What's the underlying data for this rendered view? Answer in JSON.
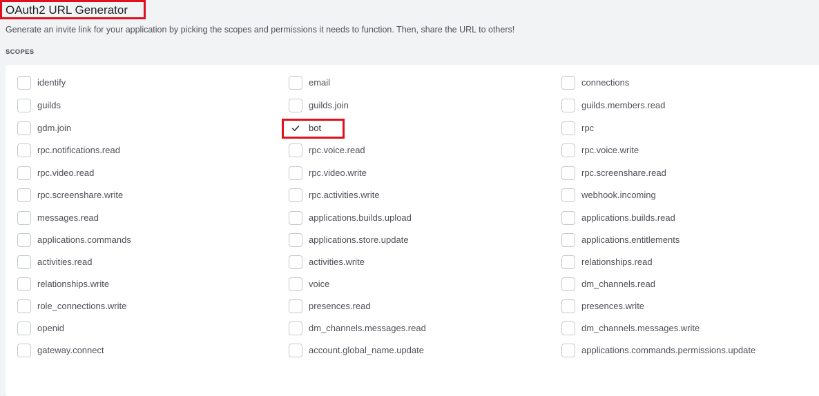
{
  "header": {
    "title": "OAuth2 URL Generator",
    "description": "Generate an invite link for your application by picking the scopes and permissions it needs to function. Then, share the URL to others!"
  },
  "scopes": {
    "section_label": "SCOPES",
    "items": [
      {
        "label": "identify",
        "checked": false
      },
      {
        "label": "email",
        "checked": false
      },
      {
        "label": "connections",
        "checked": false
      },
      {
        "label": "guilds",
        "checked": false
      },
      {
        "label": "guilds.join",
        "checked": false
      },
      {
        "label": "guilds.members.read",
        "checked": false
      },
      {
        "label": "gdm.join",
        "checked": false
      },
      {
        "label": "bot",
        "checked": true
      },
      {
        "label": "rpc",
        "checked": false
      },
      {
        "label": "rpc.notifications.read",
        "checked": false
      },
      {
        "label": "rpc.voice.read",
        "checked": false
      },
      {
        "label": "rpc.voice.write",
        "checked": false
      },
      {
        "label": "rpc.video.read",
        "checked": false
      },
      {
        "label": "rpc.video.write",
        "checked": false
      },
      {
        "label": "rpc.screenshare.read",
        "checked": false
      },
      {
        "label": "rpc.screenshare.write",
        "checked": false
      },
      {
        "label": "rpc.activities.write",
        "checked": false
      },
      {
        "label": "webhook.incoming",
        "checked": false
      },
      {
        "label": "messages.read",
        "checked": false
      },
      {
        "label": "applications.builds.upload",
        "checked": false
      },
      {
        "label": "applications.builds.read",
        "checked": false
      },
      {
        "label": "applications.commands",
        "checked": false
      },
      {
        "label": "applications.store.update",
        "checked": false
      },
      {
        "label": "applications.entitlements",
        "checked": false
      },
      {
        "label": "activities.read",
        "checked": false
      },
      {
        "label": "activities.write",
        "checked": false
      },
      {
        "label": "relationships.read",
        "checked": false
      },
      {
        "label": "relationships.write",
        "checked": false
      },
      {
        "label": "voice",
        "checked": false
      },
      {
        "label": "dm_channels.read",
        "checked": false
      },
      {
        "label": "role_connections.write",
        "checked": false
      },
      {
        "label": "presences.read",
        "checked": false
      },
      {
        "label": "presences.write",
        "checked": false
      },
      {
        "label": "openid",
        "checked": false
      },
      {
        "label": "dm_channels.messages.read",
        "checked": false
      },
      {
        "label": "dm_channels.messages.write",
        "checked": false
      },
      {
        "label": "gateway.connect",
        "checked": false
      },
      {
        "label": "account.global_name.update",
        "checked": false
      },
      {
        "label": "applications.commands.permissions.update",
        "checked": false
      }
    ]
  },
  "colors": {
    "highlight_border": "#e0101c",
    "checkbox_border": "#c4c9ce",
    "page_background": "#f2f3f5"
  }
}
